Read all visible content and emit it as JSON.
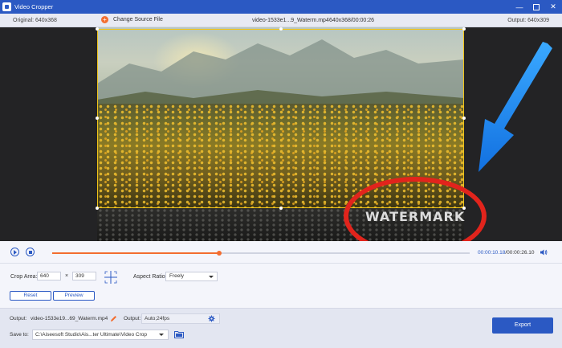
{
  "window": {
    "title": "Video Cropper",
    "controls": [
      "—",
      "✕"
    ]
  },
  "info": {
    "original": "Original: 640x368",
    "change_source": "Change Source File",
    "file_name": "video-1533e1...9_Waterm.mp4",
    "file_meta": "640x368/00:00:26",
    "output_size": "Output: 640x309"
  },
  "preview": {
    "watermark_text": "WATERMARK"
  },
  "playback": {
    "current_time": "00:00:10.18",
    "total_time": "/00:00:26.10",
    "progress": 0.4
  },
  "crop": {
    "label": "Crop Area:",
    "width": "640",
    "height": "309",
    "times": "×",
    "aspect_label": "Aspect Ratio:",
    "aspect_value": "Freely",
    "reset_label": "Reset",
    "preview_label": "Preview"
  },
  "output": {
    "file_label": "Output:",
    "file_value": "video-1533e19...69_Waterm.mp4",
    "format_label": "Output:",
    "format_value": "Auto;24fps",
    "save_label": "Save to:",
    "save_path": "C:\\Aiseesoft Studio\\Ais...ter Ultimate\\Video Crop",
    "export_label": "Export"
  },
  "colors": {
    "accent": "#2b59c3",
    "progress": "#f36d2f",
    "crop_border": "#f0c419",
    "annotation_red": "#e1241c",
    "annotation_blue": "#1e90ff"
  }
}
